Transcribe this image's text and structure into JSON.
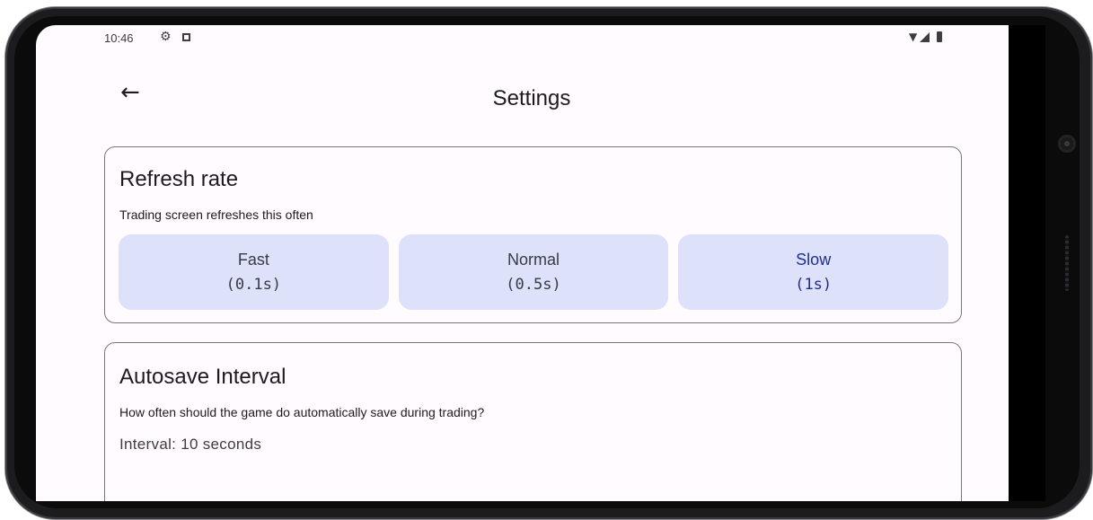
{
  "status_bar": {
    "time": "10:46",
    "icons": [
      "gear-icon",
      "image-icon",
      "wifi-icon",
      "signal-icon",
      "battery-icon"
    ]
  },
  "nav": {
    "back": "back-triangle-icon",
    "home": "home-circle-icon",
    "recents": "recents-square-icon"
  },
  "header": {
    "back_icon": "←",
    "title": "Settings"
  },
  "refresh_card": {
    "title": "Refresh rate",
    "subtitle": "Trading screen refreshes this often",
    "options": [
      {
        "label": "Fast",
        "value": "(0.1s)"
      },
      {
        "label": "Normal",
        "value": "(0.5s)"
      },
      {
        "label": "Slow",
        "value": "(1s)"
      }
    ],
    "selected": "Slow"
  },
  "autosave_card": {
    "title": "Autosave Interval",
    "subtitle": "How often should the game do automatically save during trading?",
    "interval_text": "Interval: 10 seconds"
  },
  "colors": {
    "option_bg": "#dde1f9",
    "selected_text": "#1f2f8f",
    "screen_bg": "#fffbff"
  }
}
